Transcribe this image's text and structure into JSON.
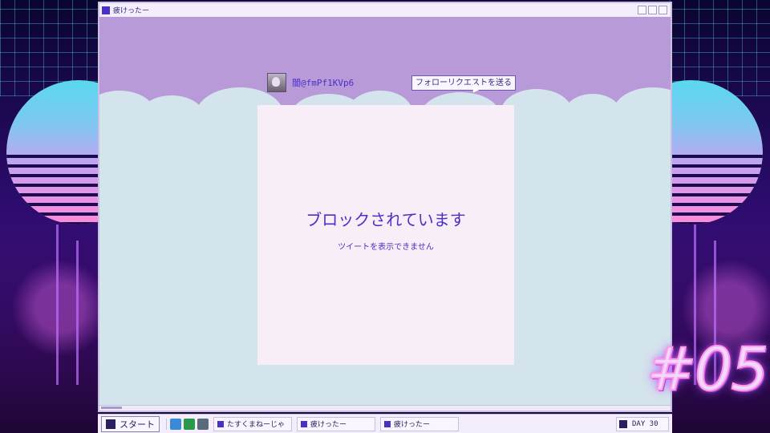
{
  "window": {
    "title": "疲けったー"
  },
  "profile": {
    "handle": "闇@fmPf1KVp6",
    "follow_button": "フォローリクエストを送る"
  },
  "notice": {
    "title": "ブロックされています",
    "subtitle": "ツイートを表示できません"
  },
  "taskbar": {
    "start_label": "スタート",
    "items": [
      "たすくまねーじゃ",
      "疲けったー",
      "疲けったー"
    ],
    "day_label": "DAY 30"
  },
  "overlay": {
    "episode": "#05"
  },
  "colors": {
    "accent": "#4a30c8",
    "sky": "#b99ad8",
    "ground": "#d4e4ec"
  }
}
